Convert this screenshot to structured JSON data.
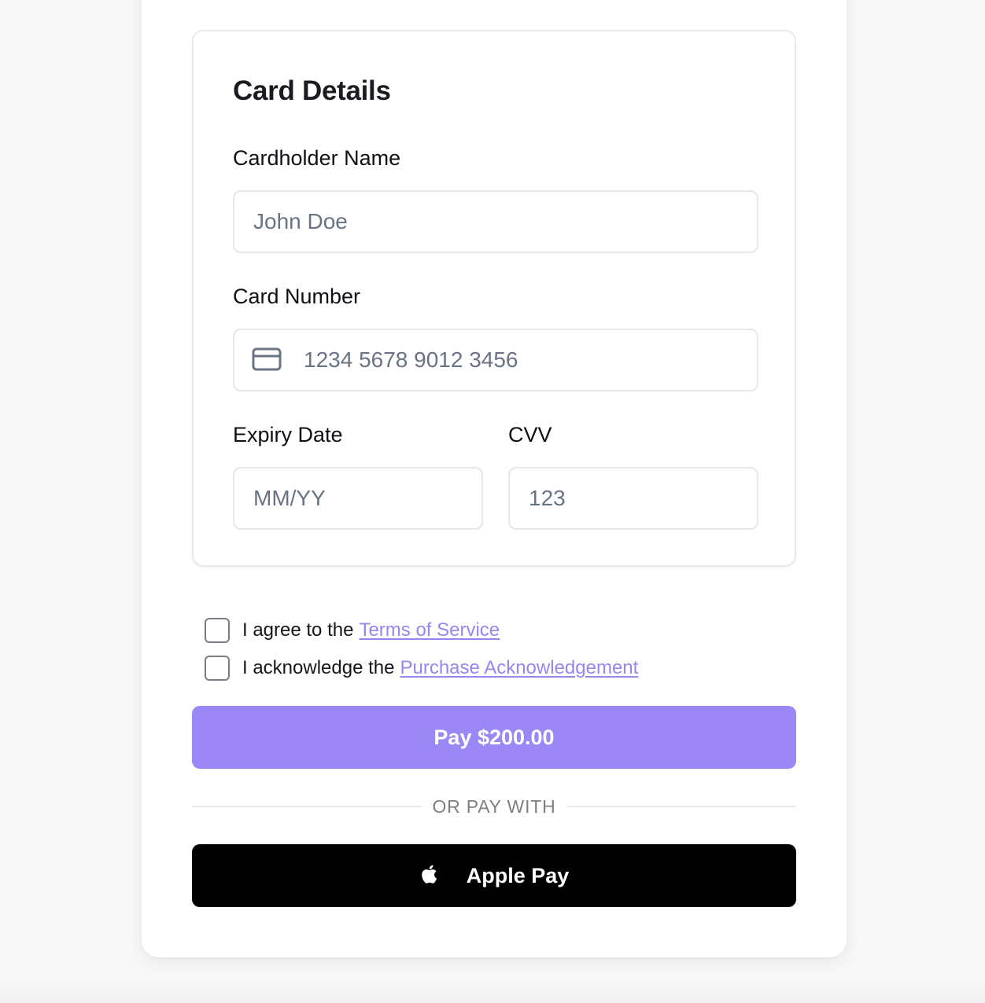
{
  "card_section": {
    "title": "Card Details"
  },
  "fields": {
    "cardholder_name": {
      "label": "Cardholder Name",
      "placeholder": "John Doe"
    },
    "card_number": {
      "label": "Card Number",
      "placeholder": "1234 5678 9012 3456",
      "icon": "credit-card-icon"
    },
    "expiry_date": {
      "label": "Expiry Date",
      "placeholder": "MM/YY"
    },
    "cvv": {
      "label": "CVV",
      "placeholder": "123"
    }
  },
  "agreements": {
    "terms": {
      "prefix": "I agree to the",
      "link": "Terms of Service",
      "checked": false
    },
    "purchase": {
      "prefix": "I acknowledge the",
      "link": "Purchase Acknowledgement",
      "checked": false
    }
  },
  "pay_button": {
    "label": "Pay $200.00"
  },
  "divider": {
    "label": "OR PAY WITH"
  },
  "apple_pay": {
    "label": "Apple Pay",
    "icon": "apple-icon"
  },
  "colors": {
    "accent": "#9b87f5",
    "link": "#9a84f2",
    "apple_button": "#000000"
  }
}
